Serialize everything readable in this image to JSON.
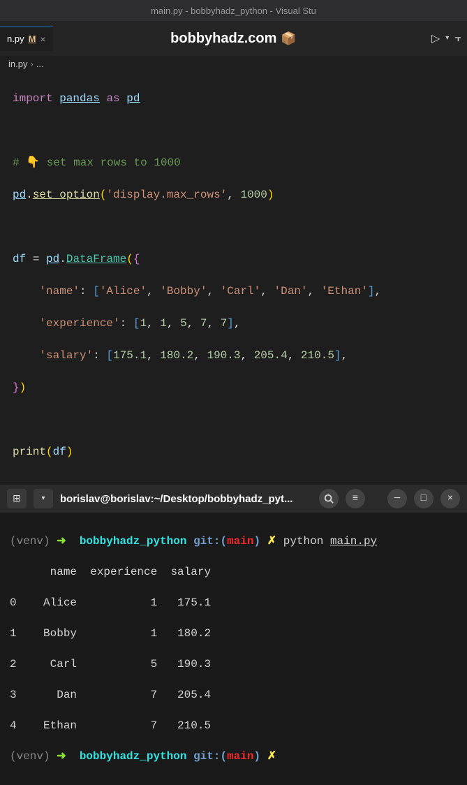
{
  "titlebar": "main.py - bobbyhadz_python - Visual Stu",
  "tab": {
    "name": "n.py",
    "modified": "M"
  },
  "centerTitle": "bobbyhadz.com",
  "breadcrumb": {
    "file": "in.py",
    "more": "..."
  },
  "code": {
    "import": "import",
    "pandas": "pandas",
    "as": "as",
    "pd": "pd",
    "comment": "# 👇️ set max rows to 1000",
    "set_option": "set_option",
    "opt_key": "'display.max_rows'",
    "opt_val": "1000",
    "df": "df",
    "DataFrame": "DataFrame",
    "k_name": "'name'",
    "names": [
      "'Alice'",
      "'Bobby'",
      "'Carl'",
      "'Dan'",
      "'Ethan'"
    ],
    "k_exp": "'experience'",
    "exps": [
      "1",
      "1",
      "5",
      "7",
      "7"
    ],
    "k_sal": "'salary'",
    "sals": [
      "175.1",
      "180.2",
      "190.3",
      "205.4",
      "210.5"
    ],
    "print": "print"
  },
  "termBar": "borislav@borislav:~/Desktop/bobbyhadz_pyt...",
  "terminal": {
    "venv": "(venv)",
    "arrow": "➜",
    "dir": "bobbyhadz_python",
    "git": "git:(",
    "branch": "main",
    "gitc": ")",
    "dirty": "✗",
    "cmd": "python",
    "file": "main.py",
    "header": "      name  experience  salary",
    "rows": [
      "0    Alice           1   175.1",
      "1    Bobby           1   180.2",
      "2     Carl           5   190.3",
      "3      Dan           7   205.4",
      "4    Ethan           7   210.5"
    ]
  }
}
